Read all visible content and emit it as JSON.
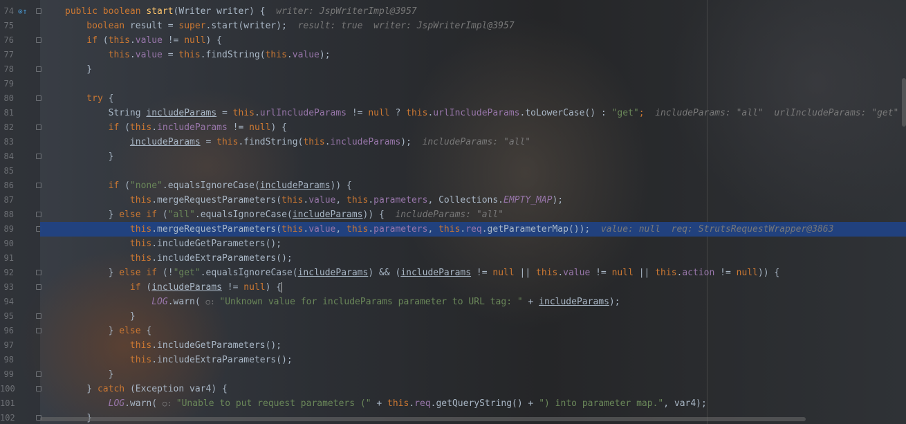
{
  "editor": {
    "language": "Java",
    "current_line": 89,
    "lines": [
      {
        "n": "74",
        "tokens": [
          [
            "kw",
            "public boolean "
          ],
          [
            "fn",
            "start"
          ],
          [
            "",
            "(Writer writer) {  "
          ],
          [
            "hint",
            "writer: JspWriterImpl@3957"
          ]
        ]
      },
      {
        "n": "75",
        "tokens": [
          [
            "kw",
            "    boolean "
          ],
          [
            "",
            "result = "
          ],
          [
            "kw",
            "super"
          ],
          [
            "",
            ".start(writer);  "
          ],
          [
            "hint",
            "result: true  writer: JspWriterImpl@3957"
          ]
        ]
      },
      {
        "n": "76",
        "tokens": [
          [
            "kw",
            "    if "
          ],
          [
            "",
            "("
          ],
          [
            "kw",
            "this"
          ],
          [
            "",
            "."
          ],
          [
            "fld",
            "value"
          ],
          [
            "",
            " != "
          ],
          [
            "kw",
            "null"
          ],
          [
            "",
            ") {"
          ]
        ]
      },
      {
        "n": "77",
        "tokens": [
          [
            "kw",
            "        this"
          ],
          [
            "",
            "."
          ],
          [
            "fld",
            "value"
          ],
          [
            "",
            " = "
          ],
          [
            "kw",
            "this"
          ],
          [
            "",
            ".findString("
          ],
          [
            "kw",
            "this"
          ],
          [
            "",
            "."
          ],
          [
            "fld",
            "value"
          ],
          [
            "",
            ");"
          ]
        ]
      },
      {
        "n": "78",
        "tokens": [
          [
            "",
            "    }"
          ]
        ]
      },
      {
        "n": "79",
        "tokens": []
      },
      {
        "n": "80",
        "tokens": [
          [
            "kw",
            "    try "
          ],
          [
            "",
            "{"
          ]
        ]
      },
      {
        "n": "81",
        "tokens": [
          [
            "",
            "        String "
          ],
          [
            "u",
            "includeParams"
          ],
          [
            "",
            " = "
          ],
          [
            "kw",
            "this"
          ],
          [
            "",
            "."
          ],
          [
            "fld",
            "urlIncludeParams"
          ],
          [
            "",
            " != "
          ],
          [
            "kw",
            "null"
          ],
          [
            "",
            " ? "
          ],
          [
            "kw",
            "this"
          ],
          [
            "",
            "."
          ],
          [
            "fld",
            "urlIncludeParams"
          ],
          [
            "",
            ".toLowerCase() : "
          ],
          [
            "str",
            "\"get\""
          ],
          [
            "kw",
            ";  "
          ],
          [
            "hint",
            "includeParams: \"all\"  urlIncludeParams: \"get\""
          ]
        ]
      },
      {
        "n": "82",
        "tokens": [
          [
            "kw",
            "        if "
          ],
          [
            "",
            "("
          ],
          [
            "kw",
            "this"
          ],
          [
            "",
            "."
          ],
          [
            "fld",
            "includeParams"
          ],
          [
            "",
            " != "
          ],
          [
            "kw",
            "null"
          ],
          [
            "",
            ") {"
          ]
        ]
      },
      {
        "n": "83",
        "tokens": [
          [
            "",
            "            "
          ],
          [
            "u",
            "includeParams"
          ],
          [
            "",
            " = "
          ],
          [
            "kw",
            "this"
          ],
          [
            "",
            ".findString("
          ],
          [
            "kw",
            "this"
          ],
          [
            "",
            "."
          ],
          [
            "fld",
            "includeParams"
          ],
          [
            "",
            ");  "
          ],
          [
            "hint",
            "includeParams: \"all\""
          ]
        ]
      },
      {
        "n": "84",
        "tokens": [
          [
            "",
            "        }"
          ]
        ]
      },
      {
        "n": "85",
        "tokens": []
      },
      {
        "n": "86",
        "tokens": [
          [
            "kw",
            "        if "
          ],
          [
            "",
            "("
          ],
          [
            "str",
            "\"none\""
          ],
          [
            "",
            ".equalsIgnoreCase("
          ],
          [
            "u",
            "includeParams"
          ],
          [
            "",
            ")) {"
          ]
        ]
      },
      {
        "n": "87",
        "tokens": [
          [
            "kw",
            "            this"
          ],
          [
            "",
            ".mergeRequestParameters("
          ],
          [
            "kw",
            "this"
          ],
          [
            "",
            "."
          ],
          [
            "fld",
            "value"
          ],
          [
            "",
            ", "
          ],
          [
            "kw",
            "this"
          ],
          [
            "",
            "."
          ],
          [
            "fld",
            "parameters"
          ],
          [
            "",
            ", Collections."
          ],
          [
            "const",
            "EMPTY_MAP"
          ],
          [
            "",
            ");"
          ]
        ]
      },
      {
        "n": "88",
        "tokens": [
          [
            "",
            "        } "
          ],
          [
            "kw",
            "else if "
          ],
          [
            "",
            "("
          ],
          [
            "str",
            "\"all\""
          ],
          [
            "",
            ".equalsIgnoreCase("
          ],
          [
            "u",
            "includeParams"
          ],
          [
            "",
            ")) {  "
          ],
          [
            "hint",
            "includeParams: \"all\""
          ]
        ]
      },
      {
        "n": "89",
        "tokens": [
          [
            "kw",
            "            this"
          ],
          [
            "",
            ".mergeRequestParameters("
          ],
          [
            "kw",
            "this"
          ],
          [
            "",
            "."
          ],
          [
            "fld",
            "value"
          ],
          [
            "",
            ", "
          ],
          [
            "kw",
            "this"
          ],
          [
            "",
            "."
          ],
          [
            "fld",
            "parameters"
          ],
          [
            "",
            ", "
          ],
          [
            "kw",
            "this"
          ],
          [
            "",
            "."
          ],
          [
            "fld",
            "req"
          ],
          [
            "",
            ".getParameterMap());  "
          ],
          [
            "hint",
            "value: null  req: StrutsRequestWrapper@3863"
          ]
        ]
      },
      {
        "n": "90",
        "tokens": [
          [
            "kw",
            "            this"
          ],
          [
            "",
            ".includeGetParameters();"
          ]
        ]
      },
      {
        "n": "91",
        "tokens": [
          [
            "kw",
            "            this"
          ],
          [
            "",
            ".includeExtraParameters();"
          ]
        ]
      },
      {
        "n": "92",
        "tokens": [
          [
            "",
            "        } "
          ],
          [
            "kw",
            "else if "
          ],
          [
            "",
            "(!"
          ],
          [
            "str",
            "\"get\""
          ],
          [
            "",
            ".equalsIgnoreCase("
          ],
          [
            "u",
            "includeParams"
          ],
          [
            "",
            ") && ("
          ],
          [
            "u",
            "includeParams"
          ],
          [
            "",
            " != "
          ],
          [
            "kw",
            "null"
          ],
          [
            "",
            " || "
          ],
          [
            "kw",
            "this"
          ],
          [
            "",
            "."
          ],
          [
            "fld",
            "value"
          ],
          [
            "",
            " != "
          ],
          [
            "kw",
            "null"
          ],
          [
            "",
            " || "
          ],
          [
            "kw",
            "this"
          ],
          [
            "",
            "."
          ],
          [
            "fld",
            "action"
          ],
          [
            "",
            " != "
          ],
          [
            "kw",
            "null"
          ],
          [
            "",
            ")) {"
          ]
        ]
      },
      {
        "n": "93",
        "tokens": [
          [
            "kw",
            "            if "
          ],
          [
            "",
            "("
          ],
          [
            "u",
            "includeParams"
          ],
          [
            "",
            " != "
          ],
          [
            "kw",
            "null"
          ],
          [
            "",
            ") {"
          ],
          [
            "caret",
            ""
          ]
        ]
      },
      {
        "n": "94",
        "tokens": [
          [
            "",
            "                "
          ],
          [
            "const",
            "LOG"
          ],
          [
            "",
            ".warn( "
          ],
          [
            "pl",
            "○: "
          ],
          [
            "str",
            "\"Unknown value for includeParams parameter to URL tag: \""
          ],
          [
            "",
            " + "
          ],
          [
            "u",
            "includeParams"
          ],
          [
            "",
            ");"
          ]
        ]
      },
      {
        "n": "95",
        "tokens": [
          [
            "",
            "            }"
          ]
        ]
      },
      {
        "n": "96",
        "tokens": [
          [
            "",
            "        } "
          ],
          [
            "kw",
            "else "
          ],
          [
            "",
            "{"
          ]
        ]
      },
      {
        "n": "97",
        "tokens": [
          [
            "kw",
            "            this"
          ],
          [
            "",
            ".includeGetParameters();"
          ]
        ]
      },
      {
        "n": "98",
        "tokens": [
          [
            "kw",
            "            this"
          ],
          [
            "",
            ".includeExtraParameters();"
          ]
        ]
      },
      {
        "n": "99",
        "tokens": [
          [
            "",
            "        }"
          ]
        ]
      },
      {
        "n": "100",
        "tokens": [
          [
            "",
            "    } "
          ],
          [
            "kw",
            "catch "
          ],
          [
            "",
            "(Exception var4) {"
          ]
        ]
      },
      {
        "n": "101",
        "tokens": [
          [
            "",
            "        "
          ],
          [
            "const",
            "LOG"
          ],
          [
            "",
            ".warn( "
          ],
          [
            "pl",
            "○: "
          ],
          [
            "str",
            "\"Unable to put request parameters (\""
          ],
          [
            "",
            " + "
          ],
          [
            "kw",
            "this"
          ],
          [
            "",
            "."
          ],
          [
            "fld",
            "req"
          ],
          [
            "",
            ".getQueryString() + "
          ],
          [
            "str",
            "\") into parameter map.\""
          ],
          [
            "",
            ", var4);"
          ]
        ]
      },
      {
        "n": "102",
        "tokens": [
          [
            "",
            "    }"
          ]
        ]
      }
    ],
    "gutter_icons": [
      {
        "line": "74",
        "icon": "override-breakpoint-icon",
        "glyph": "⊙↑"
      }
    ],
    "fold_markers": [
      "74",
      "76",
      "78",
      "80",
      "82",
      "84",
      "86",
      "88",
      "89",
      "92",
      "93",
      "95",
      "96",
      "99",
      "100",
      "102"
    ]
  }
}
